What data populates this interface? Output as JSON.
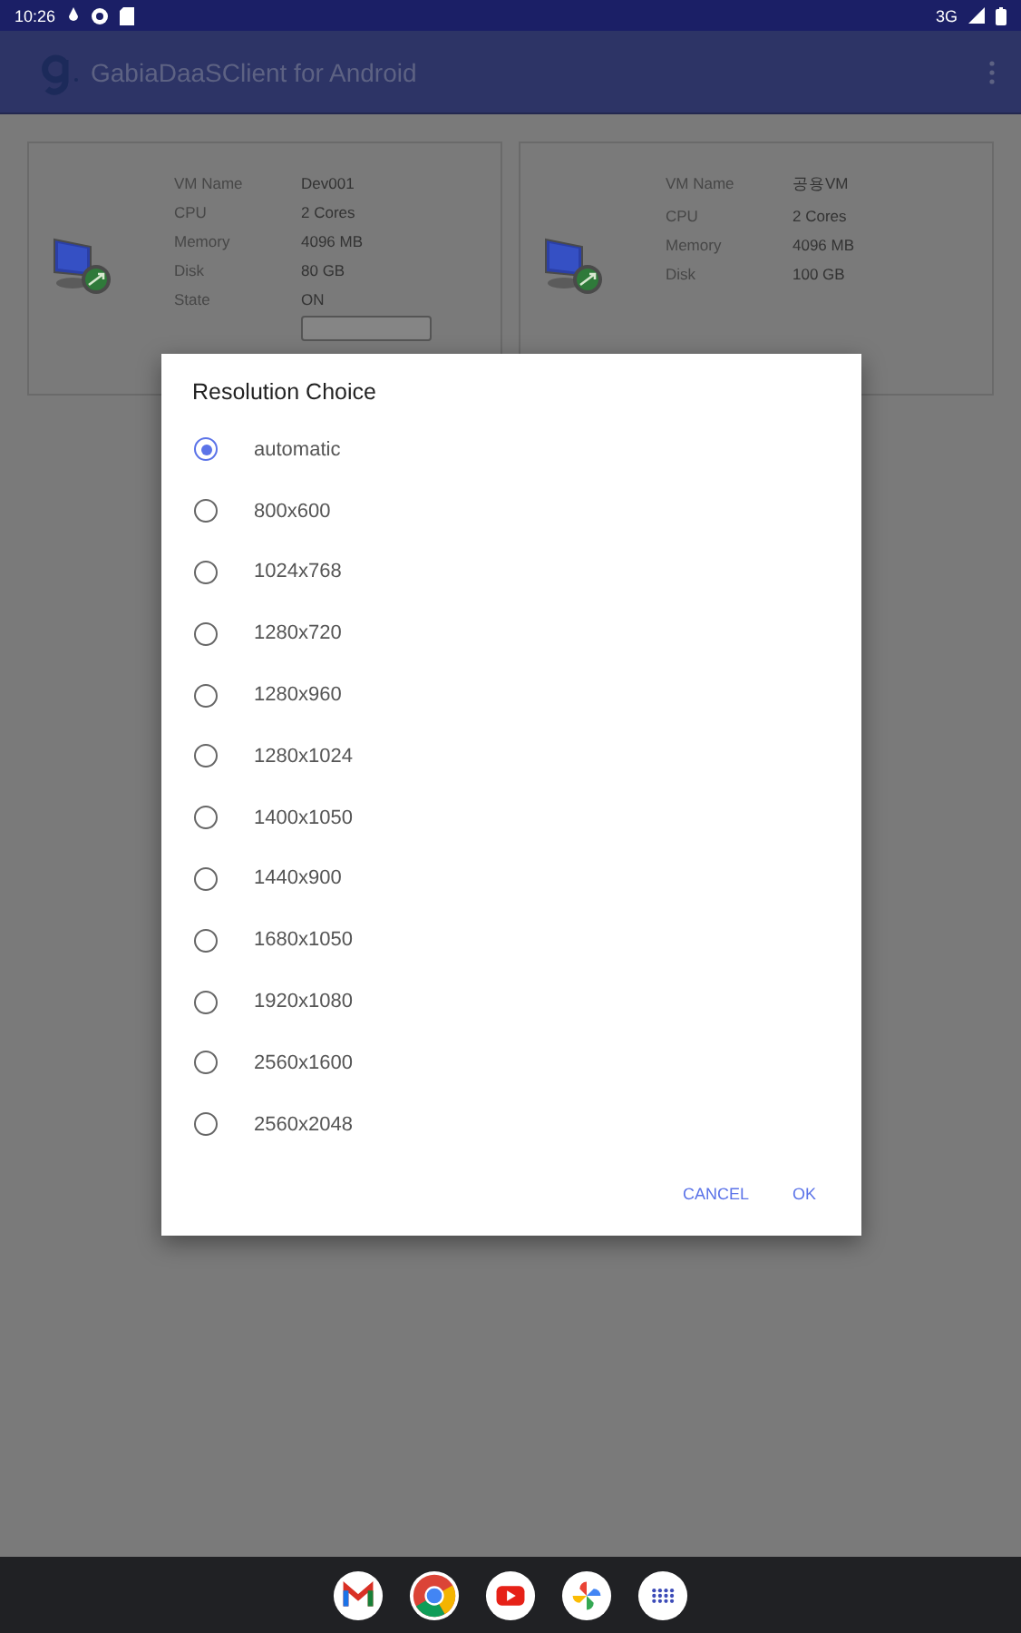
{
  "status_bar": {
    "time": "10:26",
    "network": "3G"
  },
  "app_bar": {
    "title": "GabiaDaaSClient for Android"
  },
  "vms": [
    {
      "fields": [
        {
          "label": "VM Name",
          "value": "Dev001"
        },
        {
          "label": "CPU",
          "value": "2 Cores"
        },
        {
          "label": "Memory",
          "value": "4096 MB"
        },
        {
          "label": "Disk",
          "value": "80 GB"
        },
        {
          "label": "State",
          "value": "ON"
        }
      ],
      "has_button": true
    },
    {
      "fields": [
        {
          "label": "VM Name",
          "value": "공용VM"
        },
        {
          "label": "CPU",
          "value": "2 Cores"
        },
        {
          "label": "Memory",
          "value": "4096 MB"
        },
        {
          "label": "Disk",
          "value": "100 GB"
        }
      ],
      "has_button": false
    }
  ],
  "dialog": {
    "title": "Resolution Choice",
    "options": [
      {
        "label": "automatic",
        "selected": true
      },
      {
        "label": "800x600",
        "selected": false
      },
      {
        "label": "1024x768",
        "selected": false
      },
      {
        "label": "1280x720",
        "selected": false
      },
      {
        "label": "1280x960",
        "selected": false
      },
      {
        "label": "1280x1024",
        "selected": false
      },
      {
        "label": "1400x1050",
        "selected": false
      },
      {
        "label": "1440x900",
        "selected": false
      },
      {
        "label": "1680x1050",
        "selected": false
      },
      {
        "label": "1920x1080",
        "selected": false
      },
      {
        "label": "2560x1600",
        "selected": false
      },
      {
        "label": "2560x2048",
        "selected": false
      }
    ],
    "buttons": [
      "CANCEL",
      "OK"
    ]
  }
}
